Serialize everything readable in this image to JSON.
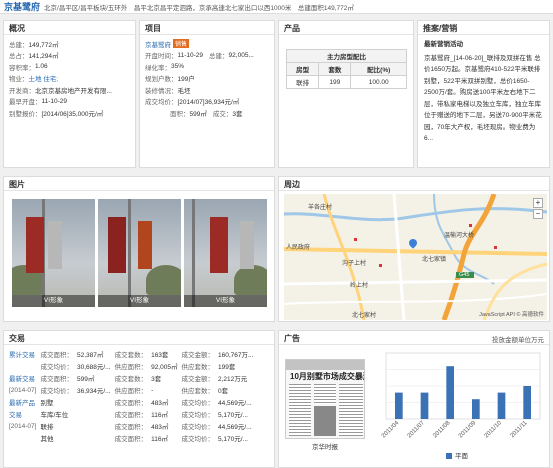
{
  "header": {
    "title": "京基鹭府",
    "address": "北京/昌平区/昌平板块/五环外　昌平北京昌平定泗路，京承高速北七家出口以西1000米　总建面积149,772㎡"
  },
  "overview": {
    "title": "概况",
    "rows": [
      {
        "k": "总建：",
        "v": "149,772㎡"
      },
      {
        "k": "总占：",
        "v": "141,294㎡"
      },
      {
        "k": "容积率：",
        "v": "1.06"
      },
      {
        "k": "物业：",
        "v": "土地 住宅;",
        "link": true
      },
      {
        "k": "开发商：",
        "v": "北京京基房地产开发有限..."
      },
      {
        "k": "最早开盘：",
        "v": "11-10-29"
      },
      {
        "k": "别墅报价：",
        "v": "[2014/06]35,000元/㎡"
      }
    ]
  },
  "project": {
    "title": "项目",
    "name": "京基鹭府",
    "status_tag": "销售",
    "rows": [
      {
        "k": "开盘时间：",
        "v": "11-10-29",
        "k2": "总建：",
        "v2": "92,005..."
      },
      {
        "k": "绿化率：",
        "v": "35%"
      },
      {
        "k": "规划户数：",
        "v": "199户"
      },
      {
        "k": "装修情况：",
        "v": "毛坯"
      },
      {
        "k": "成交均价：",
        "v": "[2014/07]36,934元/㎡"
      },
      {
        "k": "面积：",
        "v": "599㎡",
        "k2": "成交：",
        "v2": "3套"
      }
    ]
  },
  "product": {
    "title": "产品",
    "table_title": "主力房型配比",
    "columns": [
      "房型",
      "套数",
      "配比(%)"
    ],
    "rows": [
      [
        "联排",
        "199",
        "100.00"
      ]
    ]
  },
  "promo": {
    "title": "推案/营销",
    "subtitle": "最新营销活动",
    "body": "京基鹭府_[14-06-20]_联排及双拼在售 总价1650万起。京基鹭府410-522平米联排别墅，522平米双拼别墅，总价1650-2500万/套。购房送100平米左右地下二层，带私家电梯以及独立车库，独立车库位于赠送的地下二层，另送70-900平米花园，70年大产权，毛坯现房。物业费为6..."
  },
  "photos": {
    "title": "图片",
    "captions": [
      "VI形象",
      "VI形象",
      "VI形象"
    ]
  },
  "map": {
    "title": "周边",
    "labels": [
      "羊各庄村",
      "温榆河大桥",
      "人民政府",
      "沟子上村",
      "北七家镇",
      "岭上村",
      "北七家村",
      "G45"
    ],
    "zoom_in": "+",
    "zoom_out": "−",
    "copyright": "JavaScript API © 高德软件"
  },
  "trade": {
    "title": "交易",
    "rows": [
      [
        "累计交易",
        "成交面积：",
        "52,387㎡",
        "成交套数：",
        "163套",
        "成交金额：",
        "160,767万..."
      ],
      [
        "",
        "成交均价：",
        "30,688元/...",
        "供应面积：",
        "92,005㎡",
        "供应套数：",
        "199套"
      ],
      [
        "最新交易",
        "成交面积：",
        "599㎡",
        "成交套数：",
        "3套",
        "成交金额：",
        "2,212万元"
      ],
      [
        "[2014-07]",
        "成交均价：",
        "36,934元/...",
        "供应面积：",
        "-",
        "供应套数：",
        "0套"
      ],
      [
        "最新产品",
        "别墅",
        "",
        "成交面积：",
        "483㎡",
        "成交均价：",
        "44,569元/..."
      ],
      [
        "交易",
        "车库/车位",
        "",
        "成交面积：",
        "116㎡",
        "成交均价：",
        "5,170元/..."
      ],
      [
        "[2014-07]",
        "联排",
        "",
        "成交面积：",
        "483㎡",
        "成交均价：",
        "44,569元/..."
      ],
      [
        "",
        "其他",
        "",
        "成交面积：",
        "116㎡",
        "成交均价：",
        "5,170元/..."
      ]
    ]
  },
  "ad": {
    "title": "广告",
    "right_label": "投放金额单位万元",
    "newspaper_title": "10月别墅市场成交暴涨",
    "newspaper_caption": "京华时报",
    "legend": "平面"
  },
  "chart_data": {
    "type": "bar",
    "categories": [
      "2011/04",
      "2011/07",
      "2011/08",
      "2011/09",
      "2011/10",
      "2011/11"
    ],
    "series": [
      {
        "name": "平面",
        "values": [
          20,
          20,
          40,
          15,
          20,
          25
        ]
      }
    ],
    "colors": [
      "#3a72b5"
    ]
  }
}
